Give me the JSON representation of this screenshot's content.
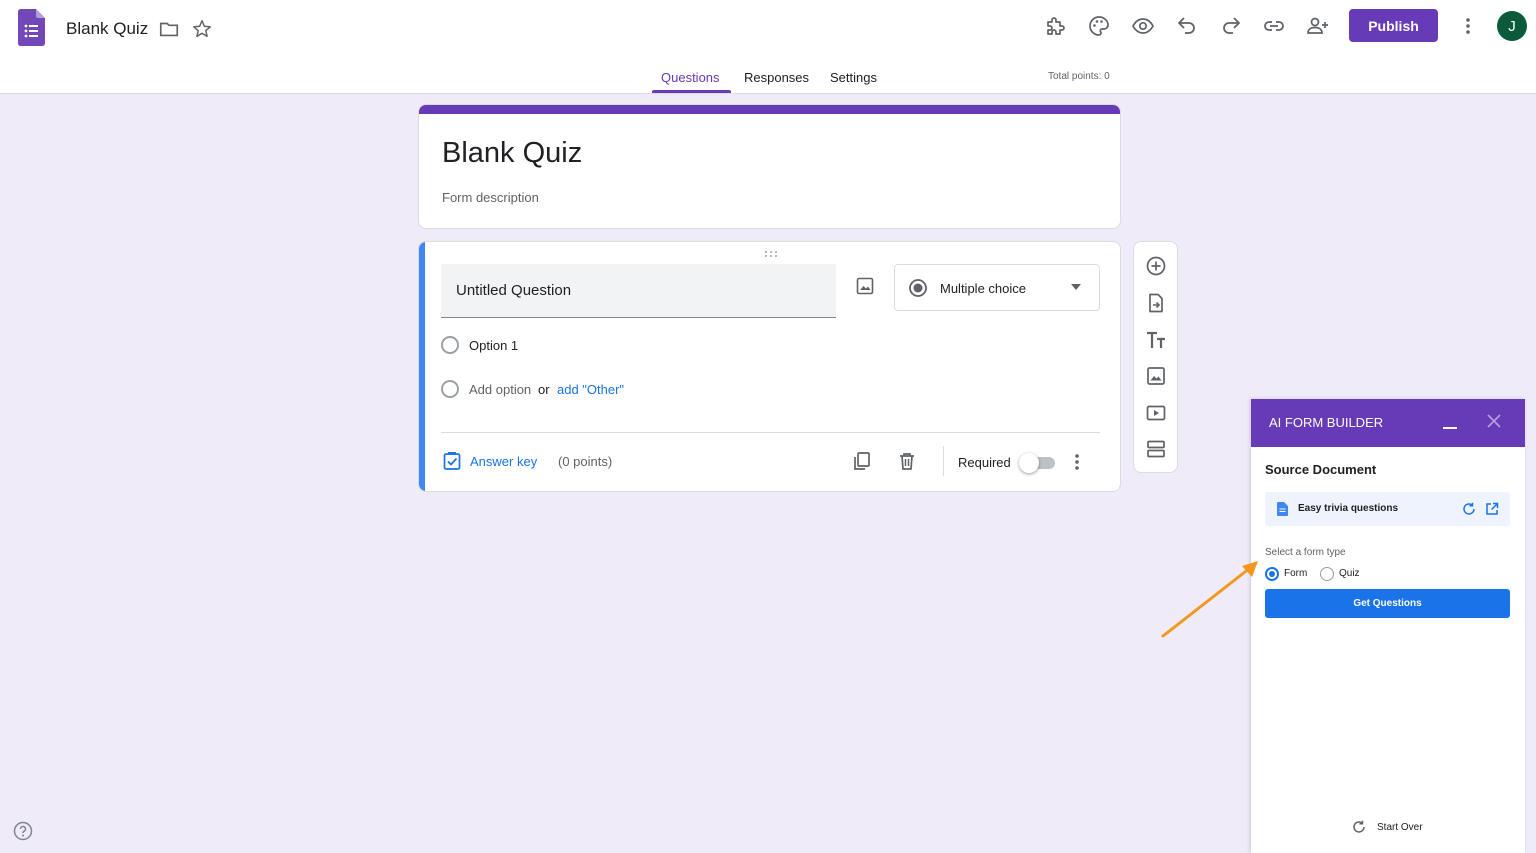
{
  "header": {
    "doc_title": "Blank Quiz",
    "publish_label": "Publish",
    "avatar_initial": "J",
    "icons": [
      "puzzle-icon",
      "palette-icon",
      "eye-icon",
      "undo-icon",
      "redo-icon",
      "link-icon",
      "add-person-icon",
      "more-vert-icon"
    ]
  },
  "tabs": {
    "items": [
      {
        "label": "Questions",
        "active": true
      },
      {
        "label": "Responses",
        "active": false
      },
      {
        "label": "Settings",
        "active": false
      }
    ],
    "total_points": "Total points: 0"
  },
  "form": {
    "title": "Blank Quiz",
    "description_placeholder": "Form description"
  },
  "question": {
    "title": "Untitled Question",
    "type": "Multiple choice",
    "options": [
      "Option 1"
    ],
    "add_option": "Add option",
    "or": "or",
    "add_other": "add \"Other\"",
    "answer_key": "Answer key",
    "points": "(0 points)",
    "required_label": "Required",
    "required": false
  },
  "ai_panel": {
    "title": "AI FORM BUILDER",
    "source_heading": "Source Document",
    "source_doc": "Easy trivia questions",
    "form_type_label": "Select a form type",
    "form_types": [
      {
        "label": "Form",
        "selected": true
      },
      {
        "label": "Quiz",
        "selected": false
      }
    ],
    "get_questions": "Get Questions",
    "start_over": "Start Over"
  },
  "colors": {
    "accent": "#673ab7",
    "background": "#f0ebf8",
    "blue": "#1a73e8",
    "annotation_arrow": "#f5961e"
  }
}
